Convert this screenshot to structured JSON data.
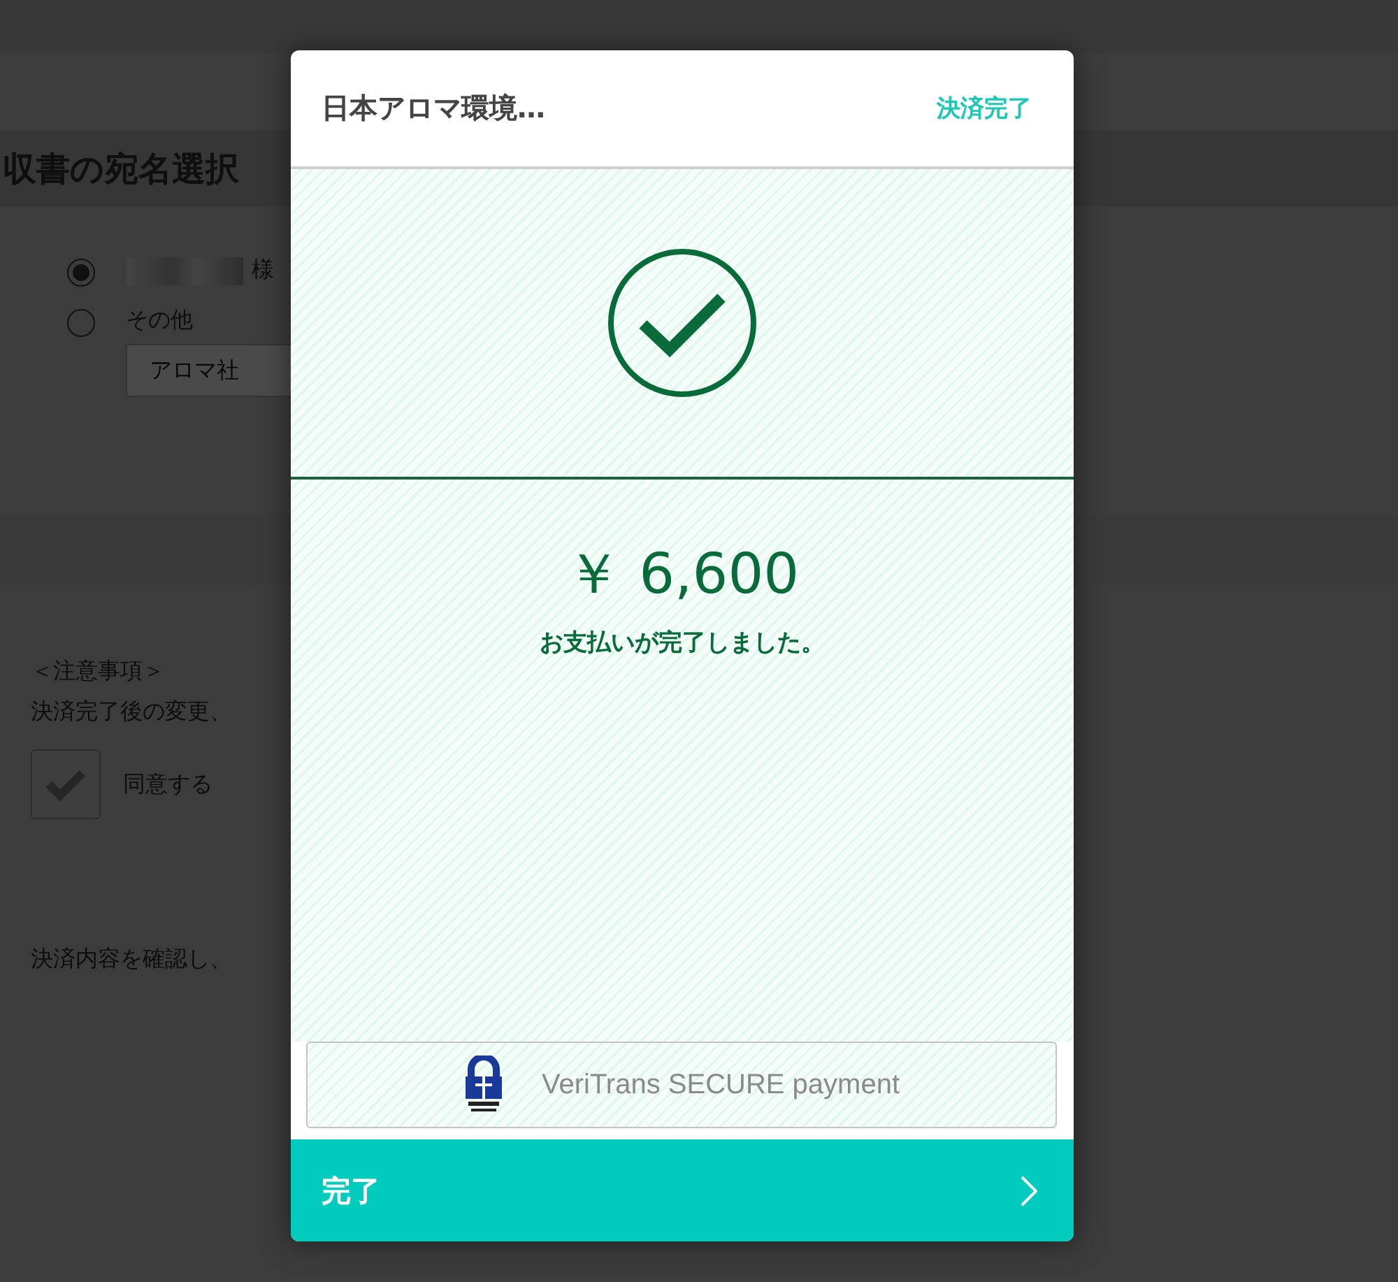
{
  "background_page": {
    "heading": "収書の宛名選択",
    "recipient_options": [
      {
        "kind": "name",
        "label": "様",
        "selected": true
      },
      {
        "kind": "other",
        "label": "その他",
        "selected": false,
        "value": "アロマ社"
      }
    ],
    "notes_title": "＜注意事項＞",
    "notes_text": "決済完了後の変更、",
    "agree": {
      "label": "同意する",
      "checked": true
    },
    "confirm_text": "決済内容を確認し、"
  },
  "modal": {
    "merchant": "日本アロマ環境…",
    "status": "決済完了",
    "amount": "￥ 6,600",
    "message": "お支払いが完了しました。",
    "secure_label": "VeriTrans SECURE payment",
    "done_button": "完了"
  }
}
